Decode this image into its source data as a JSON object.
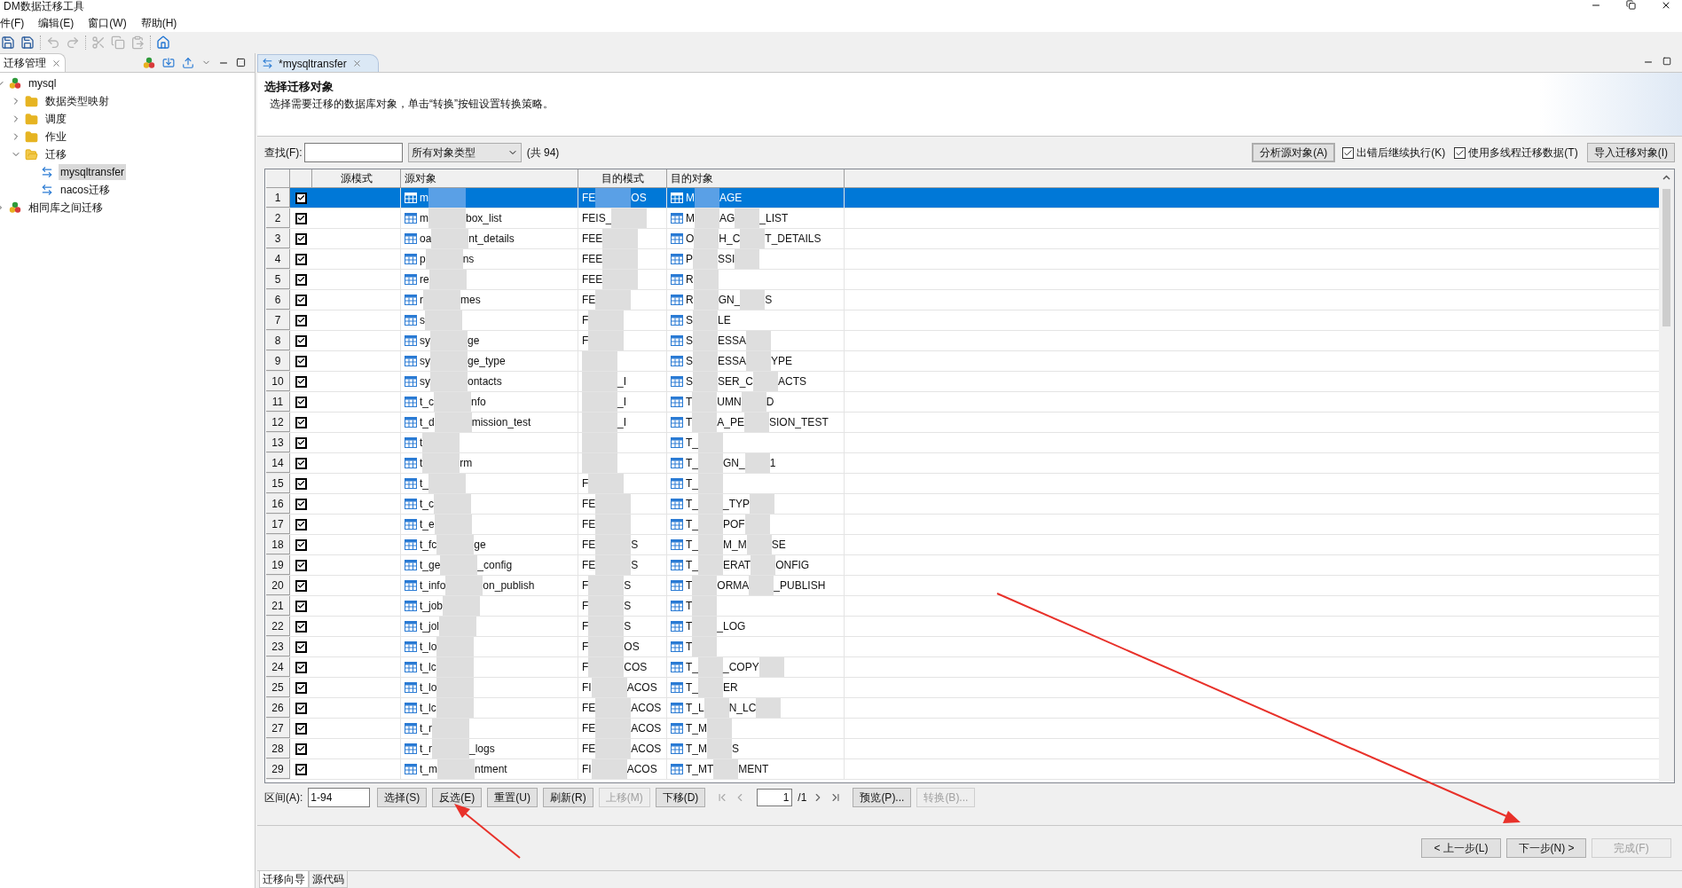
{
  "window": {
    "title": "DM数据迁移工具"
  },
  "menu": [
    "件(F)",
    "编辑(E)",
    "窗口(W)",
    "帮助(H)"
  ],
  "toolbar": [
    {
      "kind": "save",
      "disabled": false
    },
    {
      "kind": "save-all",
      "disabled": false
    },
    {
      "kind": "undo",
      "disabled": true
    },
    {
      "kind": "redo",
      "disabled": true
    },
    {
      "kind": "cut",
      "disabled": true
    },
    {
      "kind": "copy",
      "disabled": true
    },
    {
      "kind": "paste",
      "disabled": true
    },
    {
      "kind": "home",
      "disabled": false
    }
  ],
  "left_panel": {
    "tab": "迁移管理",
    "tree": [
      {
        "label": "mysql",
        "kind": "db",
        "expanded": true,
        "selected": false,
        "children": [
          {
            "label": "数据类型映射",
            "kind": "folder",
            "expanded": false,
            "selected": false
          },
          {
            "label": "调度",
            "kind": "folder",
            "expanded": false,
            "selected": false
          },
          {
            "label": "作业",
            "kind": "folder",
            "expanded": false,
            "selected": false
          },
          {
            "label": "迁移",
            "kind": "folder",
            "expanded": true,
            "selected": false,
            "children": [
              {
                "label": "mysqltransfer",
                "kind": "transfer",
                "selected": true
              },
              {
                "label": "nacos迁移",
                "kind": "transfer",
                "selected": false
              }
            ]
          }
        ]
      },
      {
        "label": "相同库之间迁移",
        "kind": "db",
        "expanded": false,
        "selected": false
      }
    ]
  },
  "editor": {
    "tab": "*mysqltransfer",
    "heading": "选择迁移对象",
    "description": "选择需要迁移的数据库对象，单击“转换”按钮设置转换策略。",
    "search": {
      "label": "查找(F):"
    },
    "type_filter": "所有对象类型",
    "count": "(共 94)",
    "analyze_button": "分析源对象(A)",
    "options": [
      {
        "label": "出错后继续执行(K)",
        "checked": true
      },
      {
        "label": "使用多线程迁移数据(T)",
        "checked": true
      }
    ],
    "import_button": "导入迁移对象(I)",
    "table": {
      "columns": [
        "源模式",
        "源对象",
        "目的模式",
        "目的对象"
      ],
      "rows": [
        {
          "n": "1",
          "checked": true,
          "selected": true,
          "source": {
            "parts": [
              "m"
            ],
            "blur_start": false,
            "blur_end": true
          },
          "schema": {
            "parts": [
              "FE",
              "OS"
            ],
            "blur_start": false,
            "blur_end": false
          },
          "target": {
            "parts": [
              "M",
              "AGE"
            ],
            "blur_start": false,
            "blur_end": false
          }
        },
        {
          "n": "2",
          "checked": true,
          "selected": false,
          "source": {
            "parts": [
              "m",
              "box_list"
            ],
            "blur_start": false,
            "blur_end": false
          },
          "schema": {
            "parts": [
              "FEIS_"
            ],
            "blur_start": false,
            "blur_end": true
          },
          "target": {
            "parts": [
              "M",
              "AG",
              "_LIST"
            ],
            "blur_start": false,
            "blur_end": false
          }
        },
        {
          "n": "3",
          "checked": true,
          "selected": false,
          "source": {
            "parts": [
              "oa",
              "nt_details"
            ],
            "blur_start": false,
            "blur_end": false
          },
          "schema": {
            "parts": [
              "FEE"
            ],
            "blur_start": false,
            "blur_end": true
          },
          "target": {
            "parts": [
              "O",
              "H_C",
              "T_DETAILS"
            ],
            "blur_start": false,
            "blur_end": false
          }
        },
        {
          "n": "4",
          "checked": true,
          "selected": false,
          "source": {
            "parts": [
              "p",
              "ns"
            ],
            "blur_start": false,
            "blur_end": false
          },
          "schema": {
            "parts": [
              "FEE"
            ],
            "blur_start": false,
            "blur_end": true
          },
          "target": {
            "parts": [
              "P",
              "SSI"
            ],
            "blur_start": false,
            "blur_end": true
          }
        },
        {
          "n": "5",
          "checked": true,
          "selected": false,
          "source": {
            "parts": [
              "re"
            ],
            "blur_start": false,
            "blur_end": true
          },
          "schema": {
            "parts": [
              "FEE"
            ],
            "blur_start": false,
            "blur_end": true
          },
          "target": {
            "parts": [
              "R"
            ],
            "blur_start": false,
            "blur_end": true
          }
        },
        {
          "n": "6",
          "checked": true,
          "selected": false,
          "source": {
            "parts": [
              "r",
              "mes"
            ],
            "blur_start": false,
            "blur_end": false
          },
          "schema": {
            "parts": [
              "FE"
            ],
            "blur_start": false,
            "blur_end": true
          },
          "target": {
            "parts": [
              "R",
              "GN_",
              "S"
            ],
            "blur_start": false,
            "blur_end": false
          }
        },
        {
          "n": "7",
          "checked": true,
          "selected": false,
          "source": {
            "parts": [
              "s"
            ],
            "blur_start": false,
            "blur_end": true
          },
          "schema": {
            "parts": [
              "F"
            ],
            "blur_start": false,
            "blur_end": true
          },
          "target": {
            "parts": [
              "S",
              "LE"
            ],
            "blur_start": false,
            "blur_end": false
          }
        },
        {
          "n": "8",
          "checked": true,
          "selected": false,
          "source": {
            "parts": [
              "sy",
              "ge"
            ],
            "blur_start": false,
            "blur_end": false
          },
          "schema": {
            "parts": [
              "F"
            ],
            "blur_start": false,
            "blur_end": true
          },
          "target": {
            "parts": [
              "S",
              "ESSA"
            ],
            "blur_start": false,
            "blur_end": true
          }
        },
        {
          "n": "9",
          "checked": true,
          "selected": false,
          "source": {
            "parts": [
              "sy",
              "ge_type"
            ],
            "blur_start": false,
            "blur_end": false
          },
          "schema": {
            "blur_start": true,
            "blur_end": false
          },
          "target": {
            "parts": [
              "S",
              "ESSA",
              "YPE"
            ],
            "blur_start": false,
            "blur_end": false
          }
        },
        {
          "n": "10",
          "checked": true,
          "selected": false,
          "source": {
            "parts": [
              "sy",
              "ontacts"
            ],
            "blur_start": false,
            "blur_end": false
          },
          "schema": {
            "parts": [
              "_I"
            ],
            "blur_start": true,
            "blur_end": false
          },
          "target": {
            "parts": [
              "S",
              "SER_C",
              "ACTS"
            ],
            "blur_start": false,
            "blur_end": false
          }
        },
        {
          "n": "11",
          "checked": true,
          "selected": false,
          "source": {
            "parts": [
              "t_c",
              "nfo"
            ],
            "blur_start": false,
            "blur_end": false
          },
          "schema": {
            "parts": [
              "_I"
            ],
            "blur_start": true,
            "blur_end": false
          },
          "target": {
            "parts": [
              "T",
              "UMN",
              "D"
            ],
            "blur_start": false,
            "blur_end": false
          }
        },
        {
          "n": "12",
          "checked": true,
          "selected": false,
          "source": {
            "parts": [
              "t_d",
              "mission_test"
            ],
            "blur_start": false,
            "blur_end": false
          },
          "schema": {
            "parts": [
              "_I"
            ],
            "blur_start": true,
            "blur_end": false
          },
          "target": {
            "parts": [
              "T",
              "A_PE",
              "SION_TEST"
            ],
            "blur_start": false,
            "blur_end": false
          }
        },
        {
          "n": "13",
          "checked": true,
          "selected": false,
          "source": {
            "parts": [
              "t"
            ],
            "blur_start": false,
            "blur_end": true
          },
          "schema": {
            "blur_start": true,
            "blur_end": false
          },
          "target": {
            "parts": [
              "T_"
            ],
            "blur_start": false,
            "blur_end": true
          }
        },
        {
          "n": "14",
          "checked": true,
          "selected": false,
          "source": {
            "parts": [
              "t",
              "rm"
            ],
            "blur_start": false,
            "blur_end": false
          },
          "schema": {
            "blur_start": true,
            "blur_end": false
          },
          "target": {
            "parts": [
              "T_",
              "GN_",
              "1"
            ],
            "blur_start": false,
            "blur_end": false
          }
        },
        {
          "n": "15",
          "checked": true,
          "selected": false,
          "source": {
            "parts": [
              "t_"
            ],
            "blur_start": false,
            "blur_end": true
          },
          "schema": {
            "parts": [
              "F"
            ],
            "blur_start": false,
            "blur_end": true
          },
          "target": {
            "parts": [
              "T_"
            ],
            "blur_start": false,
            "blur_end": true
          }
        },
        {
          "n": "16",
          "checked": true,
          "selected": false,
          "source": {
            "parts": [
              "t_c"
            ],
            "blur_start": false,
            "blur_end": true
          },
          "schema": {
            "parts": [
              "FE"
            ],
            "blur_start": false,
            "blur_end": true
          },
          "target": {
            "parts": [
              "T_",
              "_TYP"
            ],
            "blur_start": false,
            "blur_end": true
          }
        },
        {
          "n": "17",
          "checked": true,
          "selected": false,
          "source": {
            "parts": [
              "t_e"
            ],
            "blur_start": false,
            "blur_end": true
          },
          "schema": {
            "parts": [
              "FE"
            ],
            "blur_start": false,
            "blur_end": true
          },
          "target": {
            "parts": [
              "T_",
              "POF"
            ],
            "blur_start": false,
            "blur_end": true
          }
        },
        {
          "n": "18",
          "checked": true,
          "selected": false,
          "source": {
            "parts": [
              "t_fc",
              "ge"
            ],
            "blur_start": false,
            "blur_end": false
          },
          "schema": {
            "parts": [
              "FE",
              "S"
            ],
            "blur_start": false,
            "blur_end": false
          },
          "target": {
            "parts": [
              "T_",
              "M_M",
              "SE"
            ],
            "blur_start": false,
            "blur_end": false
          }
        },
        {
          "n": "19",
          "checked": true,
          "selected": false,
          "source": {
            "parts": [
              "t_ge",
              "_config"
            ],
            "blur_start": false,
            "blur_end": false
          },
          "schema": {
            "parts": [
              "FE",
              "S"
            ],
            "blur_start": false,
            "blur_end": false
          },
          "target": {
            "parts": [
              "T_",
              "ERAT",
              "ONFIG"
            ],
            "blur_start": false,
            "blur_end": false
          }
        },
        {
          "n": "20",
          "checked": true,
          "selected": false,
          "source": {
            "parts": [
              "t_info",
              "on_publish"
            ],
            "blur_start": false,
            "blur_end": false
          },
          "schema": {
            "parts": [
              "F",
              "S"
            ],
            "blur_start": false,
            "blur_end": false
          },
          "target": {
            "parts": [
              "T",
              "ORMA",
              "_PUBLISH"
            ],
            "blur_start": false,
            "blur_end": false
          }
        },
        {
          "n": "21",
          "checked": true,
          "selected": false,
          "source": {
            "parts": [
              "t_job"
            ],
            "blur_start": false,
            "blur_end": true
          },
          "schema": {
            "parts": [
              "F",
              "S"
            ],
            "blur_start": false,
            "blur_end": false
          },
          "target": {
            "parts": [
              "T"
            ],
            "blur_start": false,
            "blur_end": true
          }
        },
        {
          "n": "22",
          "checked": true,
          "selected": false,
          "source": {
            "parts": [
              "t_jol"
            ],
            "blur_start": false,
            "blur_end": true
          },
          "schema": {
            "parts": [
              "F",
              "S"
            ],
            "blur_start": false,
            "blur_end": false
          },
          "target": {
            "parts": [
              "T",
              "_LOG"
            ],
            "blur_start": false,
            "blur_end": false
          }
        },
        {
          "n": "23",
          "checked": true,
          "selected": false,
          "source": {
            "parts": [
              "t_lo"
            ],
            "blur_start": false,
            "blur_end": true
          },
          "schema": {
            "parts": [
              "F",
              "OS"
            ],
            "blur_start": false,
            "blur_end": false
          },
          "target": {
            "parts": [
              "T"
            ],
            "blur_start": false,
            "blur_end": true
          }
        },
        {
          "n": "24",
          "checked": true,
          "selected": false,
          "source": {
            "parts": [
              "t_lc"
            ],
            "blur_start": false,
            "blur_end": true
          },
          "schema": {
            "parts": [
              "F",
              "COS"
            ],
            "blur_start": false,
            "blur_end": false
          },
          "target": {
            "parts": [
              "T_",
              "_COPY"
            ],
            "blur_start": false,
            "blur_end": true
          }
        },
        {
          "n": "25",
          "checked": true,
          "selected": false,
          "source": {
            "parts": [
              "t_lo"
            ],
            "blur_start": false,
            "blur_end": true
          },
          "schema": {
            "parts": [
              "FI",
              "ACOS"
            ],
            "blur_start": false,
            "blur_end": false
          },
          "target": {
            "parts": [
              "T_",
              "ER"
            ],
            "blur_start": false,
            "blur_end": false
          }
        },
        {
          "n": "26",
          "checked": true,
          "selected": false,
          "source": {
            "parts": [
              "t_lc"
            ],
            "blur_start": false,
            "blur_end": true
          },
          "schema": {
            "parts": [
              "FE",
              "ACOS"
            ],
            "blur_start": false,
            "blur_end": false
          },
          "target": {
            "parts": [
              "T_L",
              "N_LC"
            ],
            "blur_start": false,
            "blur_end": true
          }
        },
        {
          "n": "27",
          "checked": true,
          "selected": false,
          "source": {
            "parts": [
              "t_r"
            ],
            "blur_start": false,
            "blur_end": true
          },
          "schema": {
            "parts": [
              "FE",
              "ACOS"
            ],
            "blur_start": false,
            "blur_end": false
          },
          "target": {
            "parts": [
              "T_M"
            ],
            "blur_start": false,
            "blur_end": true
          }
        },
        {
          "n": "28",
          "checked": true,
          "selected": false,
          "source": {
            "parts": [
              "t_r",
              "_logs"
            ],
            "blur_start": false,
            "blur_end": false
          },
          "schema": {
            "parts": [
              "FE",
              "ACOS"
            ],
            "blur_start": false,
            "blur_end": false
          },
          "target": {
            "parts": [
              "T_M",
              "S"
            ],
            "blur_start": false,
            "blur_end": false
          }
        },
        {
          "n": "29",
          "checked": true,
          "selected": false,
          "source": {
            "parts": [
              "t_m",
              "ntment"
            ],
            "blur_start": false,
            "blur_end": false
          },
          "schema": {
            "parts": [
              "FI",
              "ACOS"
            ],
            "blur_start": false,
            "blur_end": false
          },
          "target": {
            "parts": [
              "T_MT",
              "MENT"
            ],
            "blur_start": false,
            "blur_end": false
          }
        }
      ]
    },
    "range": {
      "label": "区间(A):",
      "value": "1-94"
    },
    "actions": [
      {
        "label": "选择(S)",
        "disabled": false
      },
      {
        "label": "反选(E)",
        "disabled": false
      },
      {
        "label": "重置(U)",
        "disabled": false
      },
      {
        "label": "刷新(R)",
        "disabled": false
      },
      {
        "label": "上移(M)",
        "disabled": true
      },
      {
        "label": "下移(D)",
        "disabled": false
      }
    ],
    "pager": {
      "first_disabled": true,
      "prev_disabled": true,
      "page": "1",
      "total": "/1",
      "next_disabled": false,
      "last_disabled": false
    },
    "more_actions": [
      {
        "label": "预览(P)...",
        "disabled": false
      },
      {
        "label": "转换(B)...",
        "disabled": true
      }
    ],
    "wizard_buttons": [
      {
        "label": "< 上一步(L)",
        "disabled": false
      },
      {
        "label": "下一步(N) >",
        "disabled": false
      },
      {
        "label": "完成(F)",
        "disabled": true
      }
    ],
    "bottom_tabs": [
      {
        "label": "迁移向导",
        "selected": true
      },
      {
        "label": "源代码",
        "selected": false
      }
    ]
  }
}
